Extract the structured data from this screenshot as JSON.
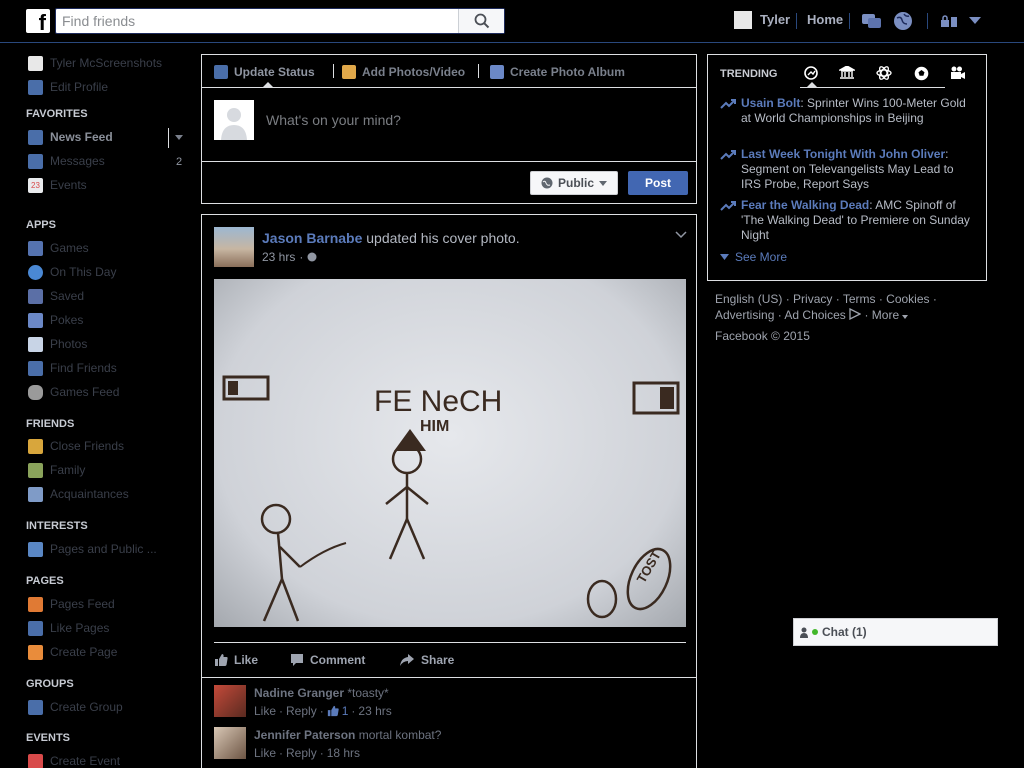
{
  "colors": {
    "brand_blue": "#4267b2",
    "link_blue": "#5b7bbb",
    "border": "#dddfe2",
    "online_green": "#42b72a",
    "background": "#000000"
  },
  "topbar": {
    "logo": "f",
    "search_placeholder": "Find friends",
    "user_name": "Tyler",
    "home_label": "Home",
    "icons": [
      "friends-icon",
      "messages-icon",
      "notifications-globe-icon",
      "privacy-lock-icon",
      "account-dropdown-icon"
    ]
  },
  "leftnav": {
    "profile_name": "Tyler McScreenshots",
    "edit_profile": "Edit Profile",
    "sections": [
      {
        "title": "FAVORITES",
        "items": [
          {
            "label": "News Feed",
            "icon": "news-feed-icon",
            "color": "#4a6ea9"
          },
          {
            "label": "Messages",
            "icon": "messages-icon",
            "color": "#4a6ea9",
            "count": "2"
          },
          {
            "label": "Events",
            "icon": "calendar-icon",
            "color": "#e9ebee"
          }
        ]
      },
      {
        "title": "APPS",
        "items": [
          {
            "label": "Games",
            "icon": "games-icon",
            "color": "#5573b0"
          },
          {
            "label": "On This Day",
            "icon": "on-this-day-icon",
            "color": "#4a88d4"
          },
          {
            "label": "Saved",
            "icon": "saved-icon",
            "color": "#5b6fa6"
          },
          {
            "label": "Pokes",
            "icon": "pokes-icon",
            "color": "#6b88c7"
          },
          {
            "label": "Photos",
            "icon": "photos-icon",
            "color": "#c8d4e6"
          },
          {
            "label": "Find Friends",
            "icon": "find-friends-icon",
            "color": "#4a6ea9"
          },
          {
            "label": "Games Feed",
            "icon": "games-feed-icon",
            "color": "#9a9a9a"
          }
        ]
      },
      {
        "title": "FRIENDS",
        "items": [
          {
            "label": "Close Friends",
            "icon": "close-friends-icon",
            "color": "#d8a63c"
          },
          {
            "label": "Family",
            "icon": "family-icon",
            "color": "#8aa35b"
          },
          {
            "label": "Acquaintances",
            "icon": "acquaintances-icon",
            "color": "#7f9bc7"
          }
        ]
      },
      {
        "title": "INTERESTS",
        "items": [
          {
            "label": "Pages and Public ...",
            "icon": "rss-icon",
            "color": "#5a87c4"
          }
        ]
      },
      {
        "title": "PAGES",
        "items": [
          {
            "label": "Pages Feed",
            "icon": "pages-feed-icon",
            "color": "#e07a34"
          },
          {
            "label": "Like Pages",
            "icon": "like-pages-icon",
            "color": "#4a6ea9"
          },
          {
            "label": "Create Page",
            "icon": "create-page-icon",
            "color": "#e98c3b"
          }
        ]
      },
      {
        "title": "GROUPS",
        "items": [
          {
            "label": "Create Group",
            "icon": "create-group-icon",
            "color": "#4a6ea9"
          }
        ]
      },
      {
        "title": "EVENTS",
        "items": [
          {
            "label": "Create Event",
            "icon": "create-event-icon",
            "color": "#d84a4a"
          }
        ]
      }
    ]
  },
  "composer": {
    "tabs": [
      {
        "label": "Update Status",
        "icon": "pencil-icon"
      },
      {
        "label": "Add Photos/Video",
        "icon": "photo-icon"
      },
      {
        "label": "Create Photo Album",
        "icon": "album-icon"
      }
    ],
    "placeholder": "What's on your mind?",
    "privacy_label": "Public",
    "post_label": "Post"
  },
  "post": {
    "author": "Jason Barnabe",
    "action": "updated his cover photo.",
    "time": "23 hrs",
    "photo_text": [
      "FE NeCH",
      "HIM",
      "TOST"
    ],
    "actions": [
      {
        "label": "Like",
        "icon": "like-icon"
      },
      {
        "label": "Comment",
        "icon": "comment-icon"
      },
      {
        "label": "Share",
        "icon": "share-icon"
      }
    ],
    "comments": [
      {
        "name": "Nadine Granger",
        "text": "*toasty*",
        "like": "Like",
        "reply": "Reply",
        "likes": "1",
        "time": "23 hrs"
      },
      {
        "name": "Jennifer Paterson",
        "text": "mortal kombat?",
        "like": "Like",
        "reply": "Reply",
        "time": "18 hrs"
      }
    ]
  },
  "trending": {
    "title": "TRENDING",
    "categories": [
      "top-trends-icon",
      "politics-icon",
      "science-icon",
      "sports-icon",
      "entertainment-icon"
    ],
    "items": [
      {
        "topic": "Usain Bolt",
        "text": ": Sprinter Wins 100-Meter Gold at World Championships in Beijing"
      },
      {
        "topic": "Last Week Tonight With John Oliver",
        "text": ": Segment on Televangelists May Lead to IRS Probe, Report Says"
      },
      {
        "topic": "Fear the Walking Dead",
        "text": ": AMC Spinoff of 'The Walking Dead' to Premiere on Sunday Night"
      }
    ],
    "see_more": "See More"
  },
  "footer": {
    "links": [
      "English (US)",
      "Privacy",
      "Terms",
      "Cookies",
      "Advertising",
      "Ad Choices",
      "More"
    ],
    "copyright": "Facebook © 2015"
  },
  "chat": {
    "label": "Chat (1)"
  }
}
